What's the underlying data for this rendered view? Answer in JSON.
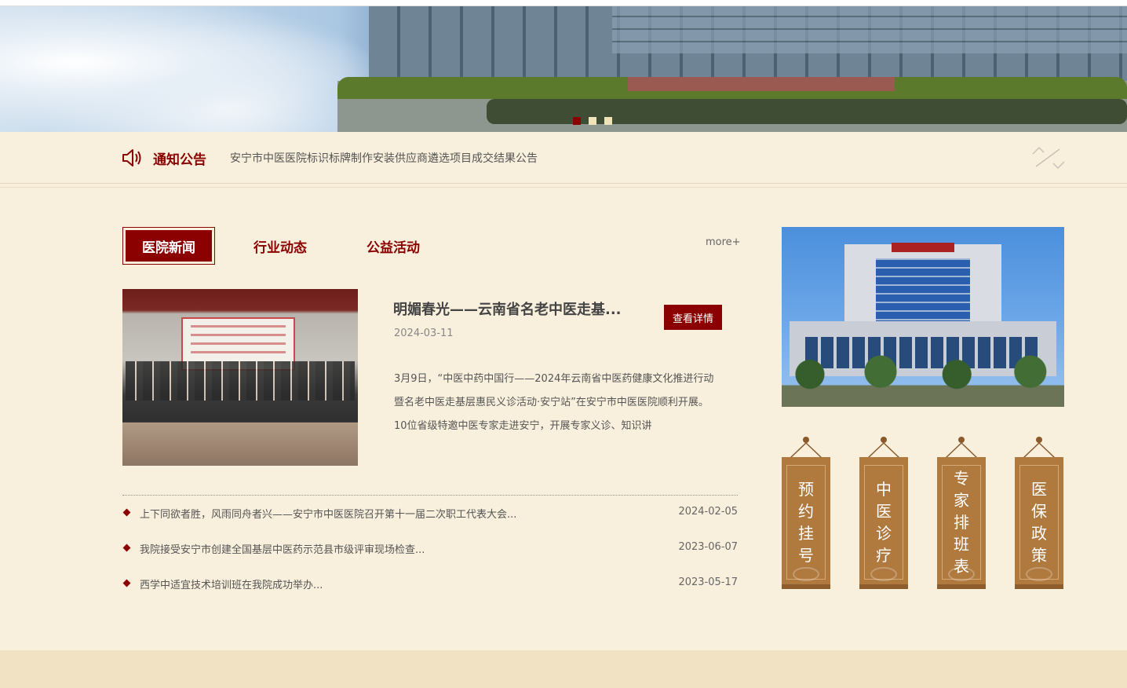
{
  "banner": {
    "slides_total": 3,
    "active_slide": 1
  },
  "notice": {
    "title": "通知公告",
    "text": "安宁市中医医院标识标牌制作安装供应商遴选项目成交结果公告"
  },
  "tabs": [
    {
      "label": "医院新闻",
      "active": true
    },
    {
      "label": "行业动态",
      "active": false
    },
    {
      "label": "公益活动",
      "active": false
    }
  ],
  "more_label": "more+",
  "featured": {
    "title": "明媚春光——云南省名老中医走基...",
    "date": "2024-03-11",
    "button": "查看详情",
    "summary": "3月9日，“中医中药中国行——2024年云南省中医药健康文化推进行动暨名老中医走基层惠民义诊活动·安宁站”在安宁市中医医院顺利开展。10位省级特邀中医专家走进安宁，开展专家义诊、知识讲"
  },
  "news_list": [
    {
      "title": "上下同欲者胜，风雨同舟者兴——安宁市中医医院召开第十一届二次职工代表大会...",
      "date": "2024-02-05"
    },
    {
      "title": "我院接受安宁市创建全国基层中医药示范县市级评审现场检查...",
      "date": "2023-06-07"
    },
    {
      "title": "西学中适宜技术培训班在我院成功举办...",
      "date": "2023-05-17"
    }
  ],
  "quick_links": [
    {
      "label": "预约挂号"
    },
    {
      "label": "中医诊疗"
    },
    {
      "label": "专家排班表"
    },
    {
      "label": "医保政策"
    }
  ],
  "colors": {
    "accent": "#8b0000",
    "background": "#f8efdc",
    "scroll": "#b07a3f"
  }
}
